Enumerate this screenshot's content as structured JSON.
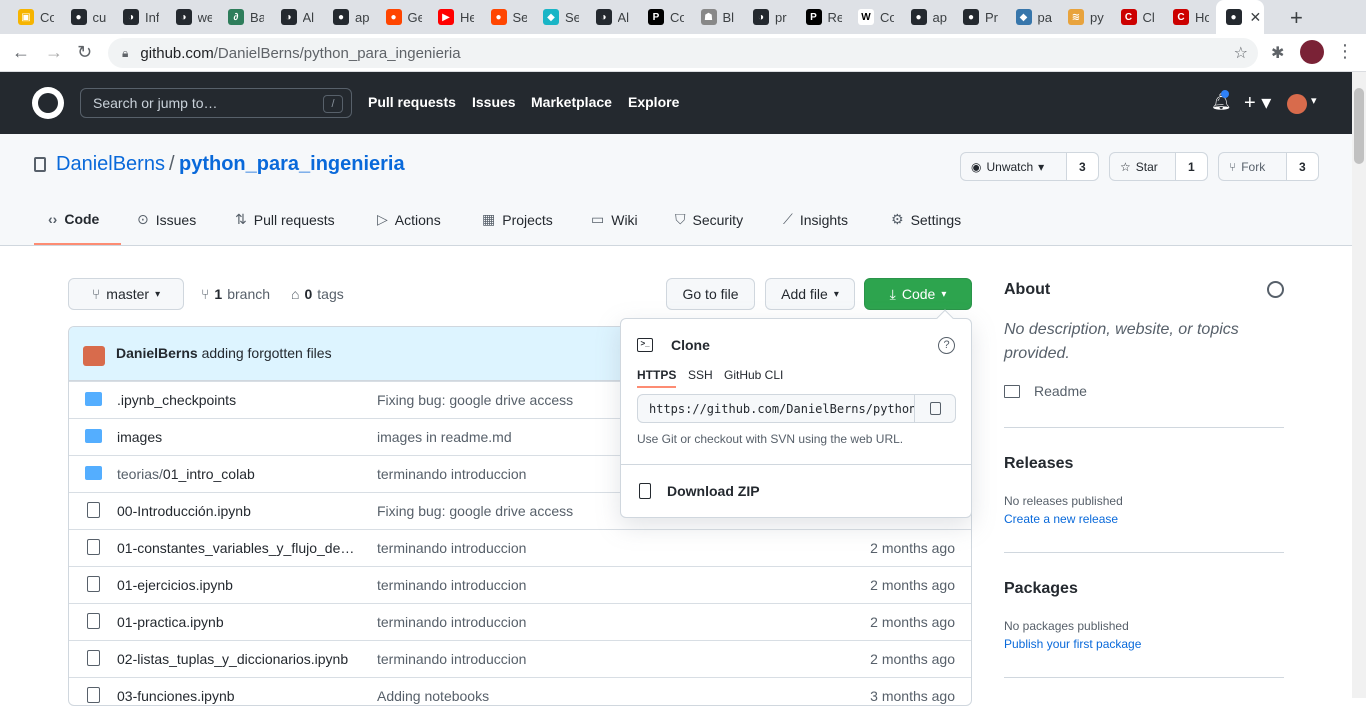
{
  "browser": {
    "tabs": [
      {
        "label": "Co",
        "color": "#f6b400",
        "glyph": "▣"
      },
      {
        "label": "cu",
        "color": "#24292f",
        "glyph": "●"
      },
      {
        "label": "Inf",
        "color": "#24292f",
        "glyph": "◑"
      },
      {
        "label": "we",
        "color": "#24292f",
        "glyph": "◑"
      },
      {
        "label": "Ba",
        "color": "#2e7d5b",
        "glyph": "∂"
      },
      {
        "label": "Al",
        "color": "#24292f",
        "glyph": "◑"
      },
      {
        "label": "ap",
        "color": "#24292f",
        "glyph": "●"
      },
      {
        "label": "Ge",
        "color": "#ff4500",
        "glyph": "●"
      },
      {
        "label": "He",
        "color": "#ff0000",
        "glyph": "▶"
      },
      {
        "label": "Se",
        "color": "#ff4500",
        "glyph": "●"
      },
      {
        "label": "Se",
        "color": "#19b5c6",
        "glyph": "◆"
      },
      {
        "label": "Al",
        "color": "#24292f",
        "glyph": "◑"
      },
      {
        "label": "Co",
        "color": "#000000",
        "glyph": "P"
      },
      {
        "label": "Bl",
        "color": "#888888",
        "glyph": "☗"
      },
      {
        "label": "pr",
        "color": "#24292f",
        "glyph": "◑"
      },
      {
        "label": "Re",
        "color": "#000000",
        "glyph": "P"
      },
      {
        "label": "Co",
        "color": "#ffffff",
        "glyph": "W"
      },
      {
        "label": "ap",
        "color": "#24292f",
        "glyph": "●"
      },
      {
        "label": "Pr",
        "color": "#24292f",
        "glyph": "●"
      },
      {
        "label": "pa",
        "color": "#3776ab",
        "glyph": "◆"
      },
      {
        "label": "py",
        "color": "#e8a33d",
        "glyph": "≋"
      },
      {
        "label": "Cl",
        "color": "#cc0000",
        "glyph": "C"
      },
      {
        "label": "Ho",
        "color": "#cc0000",
        "glyph": "C"
      },
      {
        "label": "",
        "color": "#24292f",
        "glyph": "●"
      }
    ],
    "new_tab": "+",
    "close_tab": "✕",
    "url_host": "github.com",
    "url_path": "/DanielBerns/python_para_ingenieria"
  },
  "github_header": {
    "search_placeholder": "Search or jump to…",
    "search_shortcut": "/",
    "nav": [
      "Pull requests",
      "Issues",
      "Marketplace",
      "Explore"
    ]
  },
  "repo": {
    "owner": "DanielBerns",
    "separator": "/",
    "name": "python_para_ingenieria",
    "watch_label": "Unwatch",
    "watch_count": "3",
    "star_label": "Star",
    "star_count": "1",
    "fork_label": "Fork",
    "fork_count": "3",
    "tabs": [
      "Code",
      "Issues",
      "Pull requests",
      "Actions",
      "Projects",
      "Wiki",
      "Security",
      "Insights",
      "Settings"
    ]
  },
  "toolbar": {
    "branch": "master",
    "branch_count": "1",
    "branch_word": "branch",
    "tag_count": "0",
    "tag_word": "tags",
    "go_to_file": "Go to file",
    "add_file": "Add file",
    "code": "Code"
  },
  "latest_commit": {
    "author": "DanielBerns",
    "message": "adding forgotten files"
  },
  "files": [
    {
      "type": "dir",
      "name": ".ipynb_checkpoints",
      "prefix": "",
      "message": "Fixing bug: google drive access",
      "age": ""
    },
    {
      "type": "dir",
      "name": "images",
      "prefix": "",
      "message": "images in readme.md",
      "age": ""
    },
    {
      "type": "dir",
      "name": "01_intro_colab",
      "prefix": "teorias/",
      "message": "terminando introduccion",
      "age": ""
    },
    {
      "type": "file",
      "name": "00-Introducción.ipynb",
      "prefix": "",
      "message": "Fixing bug: google drive access",
      "age": ""
    },
    {
      "type": "file",
      "name": "01-constantes_variables_y_flujo_de…",
      "prefix": "",
      "message": "terminando introduccion",
      "age": "2 months ago"
    },
    {
      "type": "file",
      "name": "01-ejercicios.ipynb",
      "prefix": "",
      "message": "terminando introduccion",
      "age": "2 months ago"
    },
    {
      "type": "file",
      "name": "01-practica.ipynb",
      "prefix": "",
      "message": "terminando introduccion",
      "age": "2 months ago"
    },
    {
      "type": "file",
      "name": "02-listas_tuplas_y_diccionarios.ipynb",
      "prefix": "",
      "message": "terminando introduccion",
      "age": "2 months ago"
    },
    {
      "type": "file",
      "name": "03-funciones.ipynb",
      "prefix": "",
      "message": "Adding notebooks",
      "age": "3 months ago"
    }
  ],
  "clone_dropdown": {
    "title": "Clone",
    "help": "?",
    "protocols": [
      "HTTPS",
      "SSH",
      "GitHub CLI"
    ],
    "url": "https://github.com/DanielBerns/python_para_ingenieria.git",
    "note": "Use Git or checkout with SVN using the web URL.",
    "download": "Download ZIP"
  },
  "sidebar": {
    "about_title": "About",
    "about_desc": "No description, website, or topics provided.",
    "readme": "Readme",
    "releases_title": "Releases",
    "releases_text": "No releases published",
    "releases_link": "Create a new release",
    "packages_title": "Packages",
    "packages_text": "No packages published",
    "packages_link": "Publish your first package"
  }
}
